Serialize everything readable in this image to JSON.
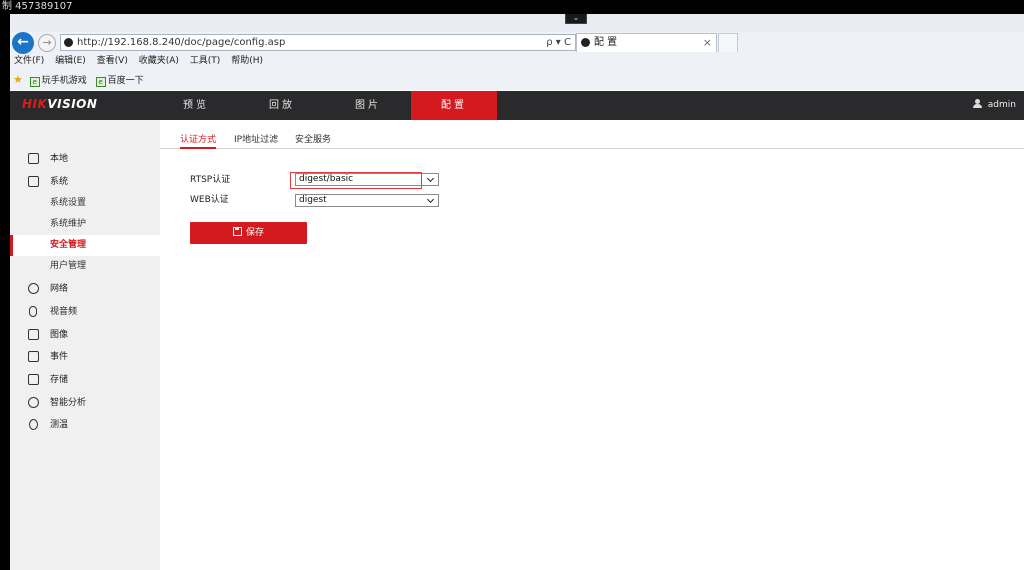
{
  "overlay": {
    "remote_label": "制 457389107"
  },
  "browser": {
    "url": "http://192.168.8.240/doc/page/config.asp",
    "address_tools": "ρ ▾ C",
    "tab_title": "配 置",
    "tab_close": "×",
    "menu": [
      "文件(F)",
      "编辑(E)",
      "查看(V)",
      "收藏夹(A)",
      "工具(T)",
      "帮助(H)"
    ],
    "favorites": [
      "玩手机游戏",
      "百度一下"
    ]
  },
  "app": {
    "logo_part1": "HIK",
    "logo_part2": "VISION",
    "nav": [
      "预览",
      "回放",
      "图片",
      "配置"
    ],
    "active_nav": "配置",
    "user": "admin",
    "sidebar": {
      "groups": [
        {
          "label": "本地",
          "icon": "monitor-icon"
        },
        {
          "label": "系统",
          "icon": "system-icon"
        },
        {
          "label": "网络",
          "icon": "network-icon"
        },
        {
          "label": "视音频",
          "icon": "microphone-icon"
        },
        {
          "label": "图像",
          "icon": "image-icon"
        },
        {
          "label": "事件",
          "icon": "calendar-icon"
        },
        {
          "label": "存储",
          "icon": "storage-icon"
        },
        {
          "label": "智能分析",
          "icon": "smart-analysis-icon"
        },
        {
          "label": "测温",
          "icon": "thermometer-icon"
        }
      ],
      "system_sub": [
        "系统设置",
        "系统维护",
        "安全管理",
        "用户管理"
      ],
      "active_sub": "安全管理"
    },
    "subtabs": [
      "认证方式",
      "IP地址过滤",
      "安全服务"
    ],
    "active_subtab": "认证方式",
    "form": {
      "rtsp_label": "RTSP认证",
      "rtsp_value": "digest/basic",
      "web_label": "WEB认证",
      "web_value": "digest"
    },
    "save_label": "保存",
    "colors": {
      "accent": "#d41a1f",
      "header": "#2a2a2c",
      "sidebar": "#f0f0f0"
    }
  }
}
